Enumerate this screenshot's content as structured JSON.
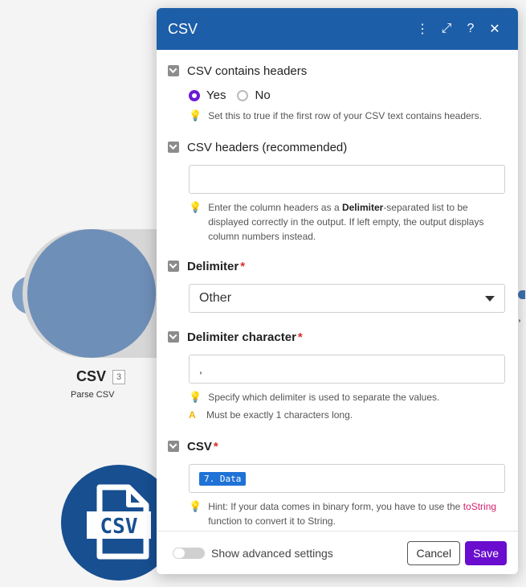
{
  "canvas": {
    "module_title": "CSV",
    "module_badge": "3",
    "module_subtitle": "Parse CSV",
    "module_icon": "csv-file-icon",
    "colors": {
      "module": "#174f91",
      "connector": "#7f9fc4"
    }
  },
  "dialog": {
    "title": "CSV",
    "header_icons": [
      "kebab-menu-icon",
      "expand-icon",
      "help-icon",
      "close-icon"
    ],
    "header_glyphs": {
      "menu": "⋮",
      "expand": "⤢",
      "help": "?",
      "close": "✕"
    },
    "colors": {
      "header": "#1d5ea8",
      "accent": "#6a0dce",
      "required": "#d92c2c"
    }
  },
  "sections": {
    "headers": {
      "label": "CSV contains headers",
      "options": {
        "yes": "Yes",
        "no": "No"
      },
      "selected": "Yes",
      "hint": "Set this to true if the first row of your CSV text contains headers."
    },
    "csv_headers": {
      "label": "CSV headers (recommended)",
      "value": "",
      "hint_pre": "Enter the column headers as a ",
      "hint_bold": "Delimiter",
      "hint_post": "-separated list to be displayed correctly in the output. If left empty, the output displays column numbers instead."
    },
    "delimiter": {
      "label": "Delimiter",
      "required_mark": "*",
      "value": "Other"
    },
    "delimiter_char": {
      "label": "Delimiter character",
      "required_mark": "*",
      "value": ",",
      "hint": "Specify which delimiter is used to separate the values.",
      "warning": "Must be exactly 1 characters long."
    },
    "csv": {
      "label": "CSV",
      "required_mark": "*",
      "pill": "7. Data",
      "hint_pre": "Hint: If your data comes in binary form, you have to use the ",
      "hint_fn": "toString",
      "hint_post": " function to convert it to String."
    }
  },
  "footer": {
    "advanced_label": "Show advanced settings",
    "cancel": "Cancel",
    "save": "Save"
  },
  "edge": {
    "mark": ","
  }
}
